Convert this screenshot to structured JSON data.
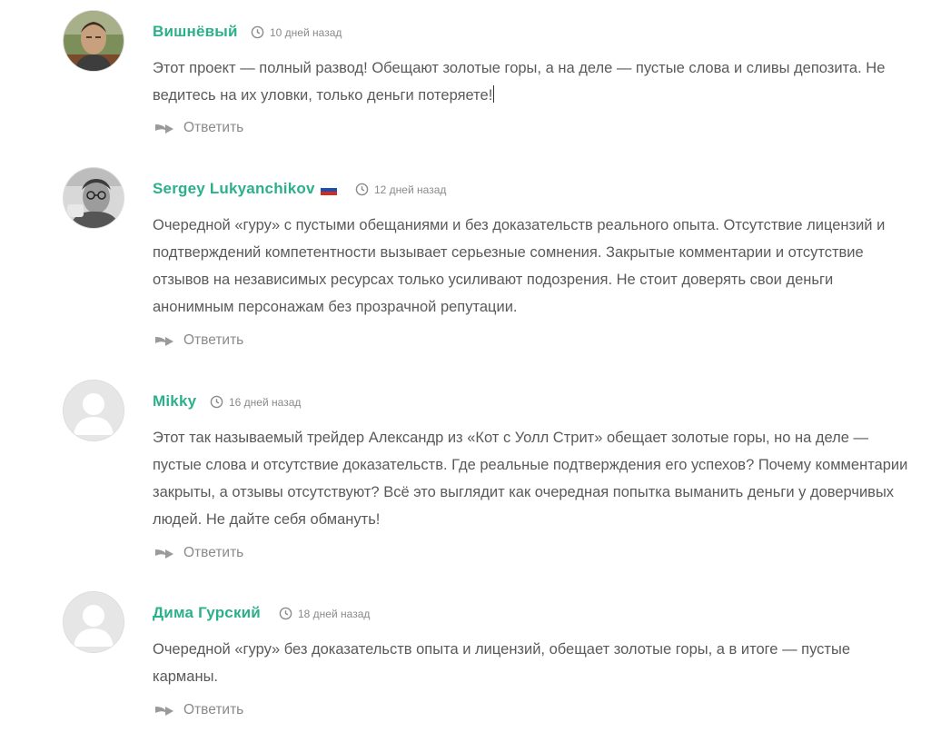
{
  "comments": [
    {
      "author": "Вишнёвый",
      "time": "10 дней назад",
      "text": "Этот проект — полный развод! Обещают золотые горы, а на деле — пустые слова и сливы депозита. Не ведитесь на их уловки, только деньги потеряете!",
      "reply": "Ответить",
      "avatar": "photo-man-outdoors"
    },
    {
      "author": "Sergey Lukyanchikov",
      "flag": "russia-flag-icon",
      "time": "12 дней назад",
      "text": "Очередной «гуру» с пустыми обещаниями и без доказательств реального опыта. Отсутствие лицензий и подтверждений компетентности вызывает серьезные сомнения. Закрытые комментарии и отсутствие отзывов на независимых ресурсах только усиливают подозрения. Не стоит доверять свои деньги анонимным персонажам без прозрачной репутации.",
      "reply": "Ответить",
      "avatar": "photo-man-glasses-bw"
    },
    {
      "author": "Mikky",
      "time": "16 дней назад",
      "text": "Этот так называемый трейдер Александр из «Кот с Уолл Стрит» обещает золотые горы, но на деле — пустые слова и отсутствие доказательств. Где реальные подтверждения его успехов? Почему комментарии закрыты, а отзывы отсутствуют? Всё это выглядит как очередная попытка выманить деньги у доверчивых людей. Не дайте себя обмануть!",
      "reply": "Ответить",
      "avatar": "default-user-icon"
    },
    {
      "author": "Дима Гурский",
      "time": "18 дней назад",
      "text": "Очередной «гуру» без доказательств опыта и лицензий, обещает золотые горы, а в итоге — пустые карманы.",
      "reply": "Ответить",
      "avatar": "default-user-icon"
    }
  ],
  "colors": {
    "author": "#2bb08b",
    "text": "#5a5a5a",
    "meta": "#8a8a8a"
  }
}
